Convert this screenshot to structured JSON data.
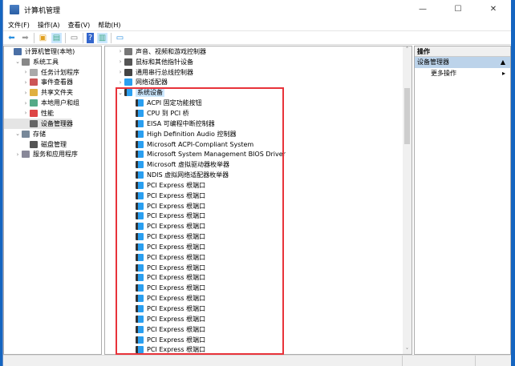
{
  "window": {
    "title": "计算机管理",
    "minimize": "—",
    "maximize": "☐",
    "close": "✕"
  },
  "menu": [
    "文件(F)",
    "操作(A)",
    "查看(V)",
    "帮助(H)"
  ],
  "left_tree": [
    {
      "label": "计算机管理(本地)",
      "indent": 0,
      "arrow": "",
      "icon": "#4a6fa5"
    },
    {
      "label": "系统工具",
      "indent": 1,
      "arrow": "⌄",
      "icon": "#888"
    },
    {
      "label": "任务计划程序",
      "indent": 2,
      "arrow": "›",
      "icon": "#aaa"
    },
    {
      "label": "事件查看器",
      "indent": 2,
      "arrow": "›",
      "icon": "#c55"
    },
    {
      "label": "共享文件夹",
      "indent": 2,
      "arrow": "›",
      "icon": "#e0b040"
    },
    {
      "label": "本地用户和组",
      "indent": 2,
      "arrow": "›",
      "icon": "#5a8"
    },
    {
      "label": "性能",
      "indent": 2,
      "arrow": "›",
      "icon": "#d44"
    },
    {
      "label": "设备管理器",
      "indent": 2,
      "arrow": "",
      "icon": "#666",
      "selected": true
    },
    {
      "label": "存储",
      "indent": 1,
      "arrow": "⌄",
      "icon": "#789"
    },
    {
      "label": "磁盘管理",
      "indent": 2,
      "arrow": "",
      "icon": "#555"
    },
    {
      "label": "服务和应用程序",
      "indent": 1,
      "arrow": "›",
      "icon": "#889"
    }
  ],
  "device_tree": {
    "categories": [
      {
        "label": "声音、视频和游戏控制器",
        "icon": "#777"
      },
      {
        "label": "鼠标和其他指针设备",
        "icon": "#555"
      },
      {
        "label": "通用串行总线控制器",
        "icon": "#444"
      },
      {
        "label": "网络适配器",
        "icon": "#2a9ff0"
      }
    ],
    "expanded": "系统设备",
    "devices": [
      "ACPI 固定功能按钮",
      "CPU 到 PCI 桥",
      "EISA 可编程中断控制器",
      "High Definition Audio 控制器",
      "Microsoft ACPI-Compliant System",
      "Microsoft System Management BIOS Driver",
      "Microsoft 虚拟驱动器枚举器",
      "NDIS 虚拟网络适配器枚举器",
      "PCI Express 根端口",
      "PCI Express 根端口",
      "PCI Express 根端口",
      "PCI Express 根端口",
      "PCI Express 根端口",
      "PCI Express 根端口",
      "PCI Express 根端口",
      "PCI Express 根端口",
      "PCI Express 根端口",
      "PCI Express 根端口",
      "PCI Express 根端口",
      "PCI Express 根端口",
      "PCI Express 根端口",
      "PCI Express 根端口",
      "PCI Express 根端口",
      "PCI Express 根端口",
      "PCI Express 根端口"
    ]
  },
  "actions": {
    "header": "操作",
    "section": "设备管理器",
    "more": "更多操作"
  },
  "colors": {
    "highlight": "#e8333a",
    "accent": "#2a9ff0"
  }
}
